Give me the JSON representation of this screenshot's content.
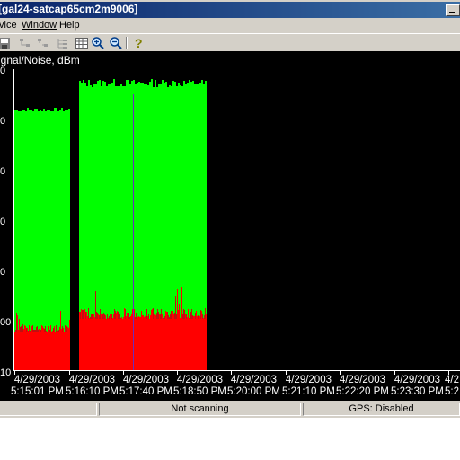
{
  "window": {
    "title": "[gal24-satcap65cm2m9006]"
  },
  "menu": [
    "vice",
    "Window",
    "Help"
  ],
  "toolbar": {
    "icons": [
      "save-icon",
      "connect-icon",
      "disconnect-icon",
      "tree-icon",
      "grid-icon",
      "zoom-in-icon",
      "zoom-out-icon",
      "help-icon"
    ]
  },
  "chart": {
    "ylabel": "ignal/Noise, dBm",
    "yticks": [
      "0",
      "0",
      "0",
      "0",
      "0",
      "00",
      "10"
    ],
    "xticks": [
      {
        "date": "4/29/2003",
        "time": "5:15:01 PM"
      },
      {
        "date": "4/29/2003",
        "time": "5:16:10 PM"
      },
      {
        "date": "4/29/2003",
        "time": "5:17:40 PM"
      },
      {
        "date": "4/29/2003",
        "time": "5:18:50 PM"
      },
      {
        "date": "4/29/2003",
        "time": "5:20:00 PM"
      },
      {
        "date": "4/29/2003",
        "time": "5:21:10 PM"
      },
      {
        "date": "4/29/2003",
        "time": "5:22:20 PM"
      },
      {
        "date": "4/29/2003",
        "time": "5:23:30 PM"
      },
      {
        "date": "4/2",
        "time": "5:2"
      }
    ],
    "colors": {
      "signal": "#00ff00",
      "noise": "#ff0000",
      "background": "#000000"
    }
  },
  "status": {
    "scan": "Not scanning",
    "gps": "GPS: Disabled"
  }
}
